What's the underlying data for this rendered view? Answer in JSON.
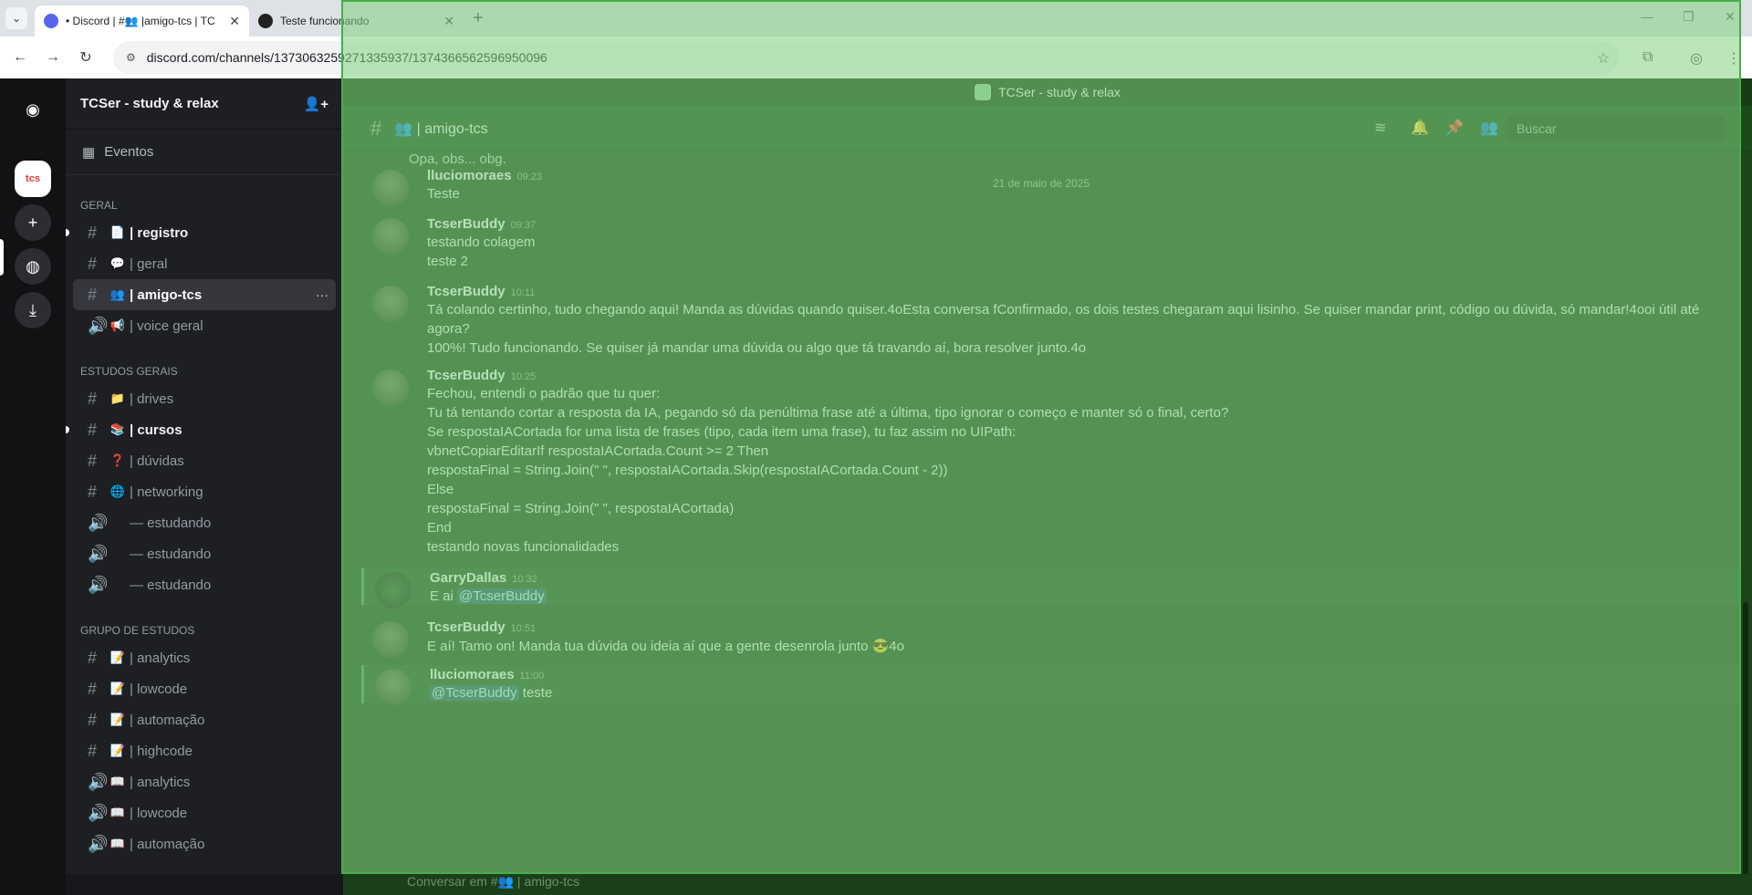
{
  "browser": {
    "tabs": [
      {
        "title": "• Discord | #👥 |amigo-tcs | TC"
      },
      {
        "title": "Teste funcionando"
      }
    ],
    "url": "discord.com/channels/1373063259271335937/1374366562596950096"
  },
  "server": {
    "name": "TCSer - study & relax",
    "tcs_label": "tcs"
  },
  "events_label": "Eventos",
  "categories": [
    {
      "name": "GERAL",
      "channels": [
        {
          "icon": "📄",
          "name": "| registro",
          "type": "text",
          "state": "unread"
        },
        {
          "icon": "💬",
          "name": "| geral",
          "type": "text",
          "state": "normal"
        },
        {
          "icon": "👥",
          "name": "| amigo-tcs",
          "type": "text",
          "state": "active"
        },
        {
          "icon": "📢",
          "name": "| voice geral",
          "type": "voice",
          "state": "normal"
        }
      ]
    },
    {
      "name": "ESTUDOS GERAIS",
      "channels": [
        {
          "icon": "📁",
          "name": "| drives",
          "type": "text",
          "state": "normal"
        },
        {
          "icon": "📚",
          "name": "| cursos",
          "type": "text",
          "state": "unread"
        },
        {
          "icon": "❓",
          "name": "| dúvidas",
          "type": "text",
          "state": "normal"
        },
        {
          "icon": "🌐",
          "name": "| networking",
          "type": "text",
          "state": "normal"
        },
        {
          "icon": "",
          "name": "— estudando",
          "type": "voice",
          "state": "normal"
        },
        {
          "icon": "",
          "name": "— estudando",
          "type": "voice",
          "state": "normal"
        },
        {
          "icon": "",
          "name": "— estudando",
          "type": "voice",
          "state": "normal"
        }
      ]
    },
    {
      "name": "GRUPO DE ESTUDOS",
      "channels": [
        {
          "icon": "📝",
          "name": "| analytics",
          "type": "text",
          "state": "normal"
        },
        {
          "icon": "📝",
          "name": "| lowcode",
          "type": "text",
          "state": "normal"
        },
        {
          "icon": "📝",
          "name": "| automação",
          "type": "text",
          "state": "normal"
        },
        {
          "icon": "📝",
          "name": "| highcode",
          "type": "text",
          "state": "normal"
        },
        {
          "icon": "📖",
          "name": "| analytics",
          "type": "voice",
          "state": "normal"
        },
        {
          "icon": "📖",
          "name": "| lowcode",
          "type": "voice",
          "state": "normal"
        },
        {
          "icon": "📖",
          "name": "| automação",
          "type": "voice",
          "state": "normal"
        }
      ]
    }
  ],
  "topbar_title": "TCSer - study & relax",
  "channel_header": {
    "name": "👥 | amigo-tcs",
    "search_placeholder": "Buscar"
  },
  "partial_line": "Opa, obs... obg.",
  "date_divider": "21 de maio de 2025",
  "messages": [
    {
      "author": "lluciomoraes",
      "time": "09:23",
      "lines": [
        "Teste"
      ]
    },
    {
      "author": "TcserBuddy",
      "time": "09:37",
      "lines": [
        "testando colagem",
        "teste 2"
      ]
    },
    {
      "author": "TcserBuddy",
      "time": "10:11",
      "lines": [
        "Tá colando certinho, tudo chegando aqui! Manda as dúvidas quando quiser.4oEsta conversa fConfirmado, os dois testes chegaram aqui lisinho. Se quiser mandar print, código ou dúvida, só mandar!4ooi útil até",
        "agora?",
        "100%! Tudo funcionando. Se quiser já mandar uma dúvida ou algo que tá travando aí, bora resolver junto.4o"
      ]
    },
    {
      "author": "TcserBuddy",
      "time": "10:25",
      "lines": [
        "Fechou, entendi o padrão que tu quer:",
        "Tu tá tentando cortar a resposta da IA, pegando só da penúltima frase até a última, tipo ignorar o começo e manter só o final, certo?",
        "Se respostaIACortada for uma lista de frases (tipo, cada item uma frase), tu faz assim no UIPath:",
        "vbnetCopiarEditarIf respostaIACortada.Count >= 2 Then",
        "respostaFinal = String.Join(\" \", respostaIACortada.Skip(respostaIACortada.Count - 2))",
        "Else",
        "respostaFinal = String.Join(\" \", respostaIACortada)",
        "End",
        "testando novas funcionalidades"
      ]
    },
    {
      "author": "GarryDallas",
      "time": "10:32",
      "pre": "E ai ",
      "mention": "@TcserBuddy",
      "post": ""
    },
    {
      "author": "TcserBuddy",
      "time": "10:51",
      "lines": [
        "E aí! Tamo on! Manda tua dúvida ou ideia aí que a gente desenrola junto 😎4o"
      ]
    },
    {
      "author": "lluciomoraes",
      "time": "11:00",
      "pre": "",
      "mention": "@TcserBuddy",
      "post": " teste"
    }
  ],
  "composer_placeholder": "Conversar em #👥 | amigo-tcs"
}
